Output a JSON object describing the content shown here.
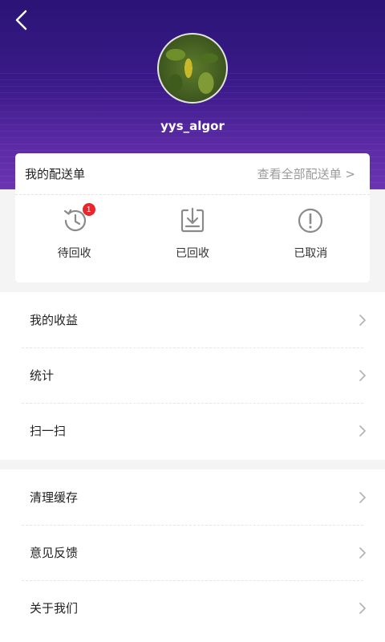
{
  "header": {
    "username": "yys_algor"
  },
  "delivery_card": {
    "title": "我的配送单",
    "view_all": "查看全部配送单 >",
    "items": [
      {
        "label": "待回收",
        "icon": "clock-history-icon",
        "badge": "1"
      },
      {
        "label": "已回收",
        "icon": "download-box-icon",
        "badge": null
      },
      {
        "label": "已取消",
        "icon": "alert-circle-icon",
        "badge": null
      }
    ]
  },
  "menu": {
    "section1": [
      {
        "label": "我的收益"
      },
      {
        "label": "统计"
      },
      {
        "label": "扫一扫"
      }
    ],
    "section2": [
      {
        "label": "清理缓存"
      },
      {
        "label": "意见反馈"
      },
      {
        "label": "关于我们"
      }
    ]
  },
  "colors": {
    "header_top": "#2a1475",
    "header_bottom": "#6b34b2",
    "badge": "#e8262b",
    "icon_gray": "#8a8a8a"
  }
}
